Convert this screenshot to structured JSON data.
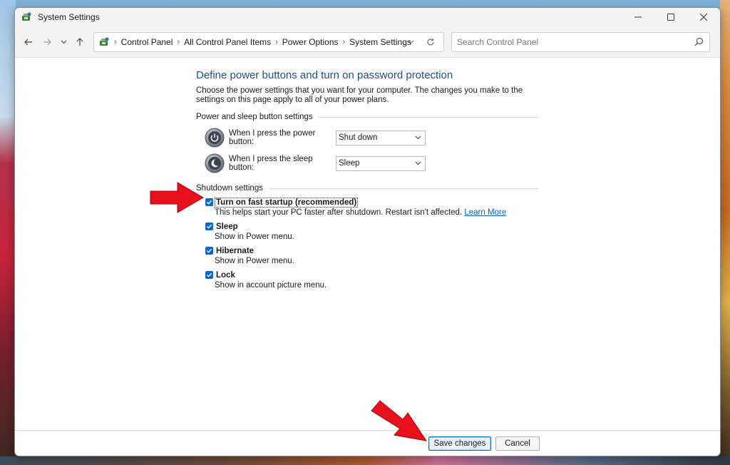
{
  "window": {
    "title": "System Settings"
  },
  "navigation": {
    "breadcrumb": [
      "Control Panel",
      "All Control Panel Items",
      "Power Options",
      "System Settings"
    ],
    "search_placeholder": "Search Control Panel"
  },
  "main": {
    "heading": "Define power buttons and turn on password protection",
    "description": "Choose the power settings that you want for your computer. The changes you make to the settings on this page apply to all of your power plans.",
    "power_section": {
      "label": "Power and sleep button settings",
      "power_button_label": "When I press the power button:",
      "power_button_value": "Shut down",
      "sleep_button_label": "When I press the sleep button:",
      "sleep_button_value": "Sleep"
    },
    "shutdown_section": {
      "label": "Shutdown settings",
      "items": [
        {
          "label": "Turn on fast startup (recommended)",
          "desc": "This helps start your PC faster after shutdown. Restart isn't affected.",
          "link": "Learn More",
          "checked": true
        },
        {
          "label": "Sleep",
          "desc": "Show in Power menu.",
          "checked": true
        },
        {
          "label": "Hibernate",
          "desc": "Show in Power menu.",
          "checked": true
        },
        {
          "label": "Lock",
          "desc": "Show in account picture menu.",
          "checked": true
        }
      ]
    }
  },
  "footer": {
    "save_label": "Save changes",
    "cancel_label": "Cancel"
  },
  "colors": {
    "accent": "#1167c6",
    "heading": "#1e4e8c",
    "link": "#0066cc",
    "annotation_arrow": "#e8101b"
  },
  "icons": [
    "control-panel-icon",
    "minimize-icon",
    "maximize-icon",
    "close-icon",
    "back-arrow-icon",
    "forward-arrow-icon",
    "recent-dropdown-icon",
    "up-arrow-icon",
    "chevron-down-icon",
    "refresh-icon",
    "search-icon",
    "power-button-icon",
    "sleep-button-icon",
    "checkmark-icon",
    "red-arrow-annotation"
  ]
}
